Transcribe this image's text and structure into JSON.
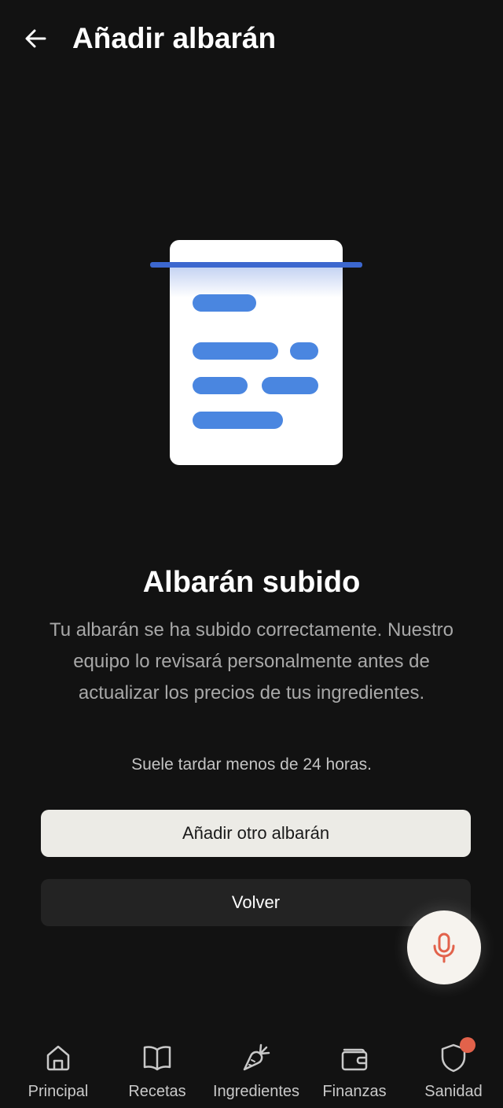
{
  "header": {
    "title": "Añadir albarán",
    "back_icon": "arrow-left-icon"
  },
  "illustration": {
    "icon": "document-scan-icon",
    "accent_color": "#3c67cf",
    "bar_color": "#4a86e0"
  },
  "status": {
    "headline": "Albarán subido",
    "description": "Tu albarán se ha subido correctamente. Nuestro equipo lo revisará personalmente antes de actualizar los precios de tus ingredientes.",
    "note": "Suele tardar menos de 24 horas."
  },
  "actions": {
    "add_another_label": "Añadir otro albarán",
    "back_label": "Volver"
  },
  "voice_button": {
    "icon": "microphone-icon",
    "color": "#e2624b"
  },
  "bottom_nav": {
    "items": [
      {
        "label": "Principal",
        "icon": "home-icon"
      },
      {
        "label": "Recetas",
        "icon": "book-icon"
      },
      {
        "label": "Ingredientes",
        "icon": "carrot-icon"
      },
      {
        "label": "Finanzas",
        "icon": "wallet-icon"
      },
      {
        "label": "Sanidad",
        "icon": "shield-icon",
        "has_badge": true
      }
    ],
    "badge_color": "#e2624b"
  }
}
